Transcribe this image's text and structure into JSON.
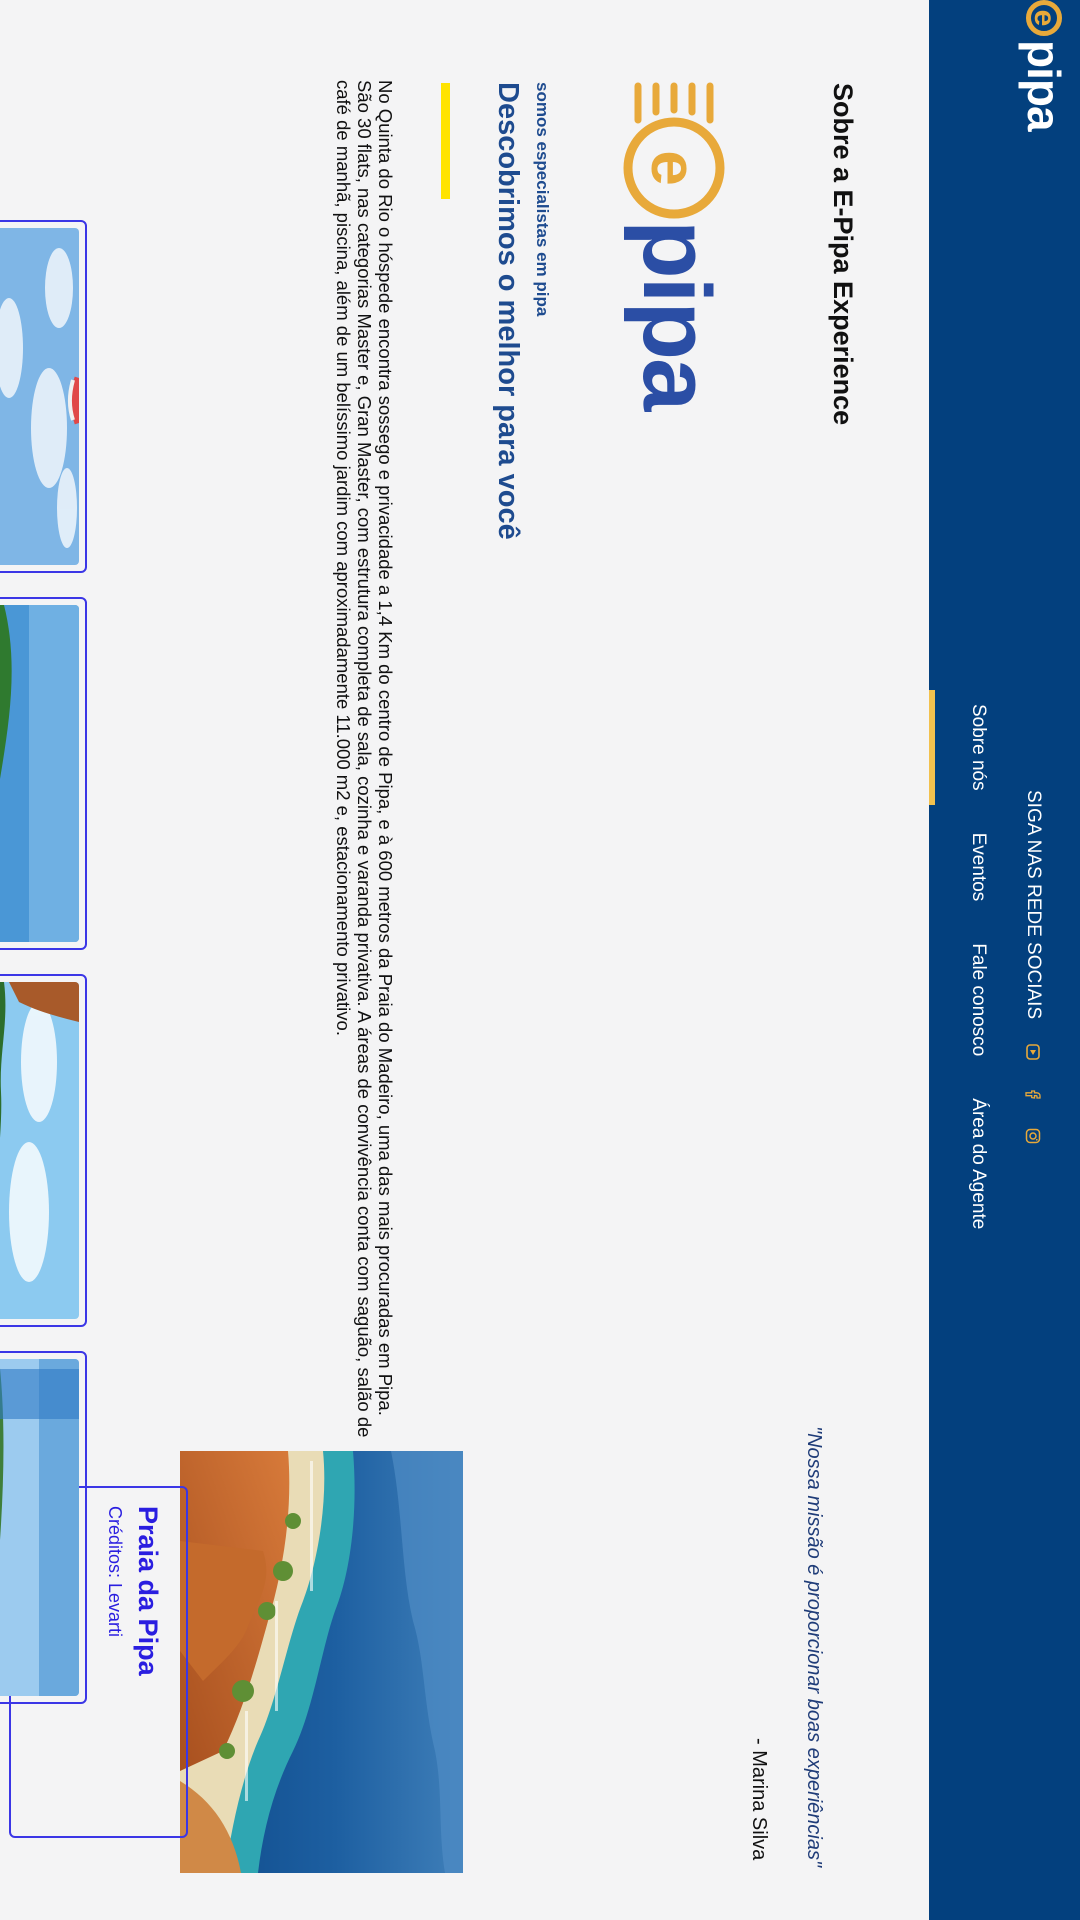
{
  "colors": {
    "header_bg": "#03407e",
    "brand_orange": "#e8a93a",
    "heading_blue": "#1e4b8f",
    "card_border": "#3b36e6",
    "accent_yellow": "#ffe300"
  },
  "header": {
    "brand": "pipa",
    "social_label": "SIGA NAS REDE SOCIAIS",
    "social_icons": [
      "youtube-icon",
      "facebook-icon",
      "instagram-icon"
    ],
    "nav": [
      {
        "label": "Sobre nós",
        "active": true
      },
      {
        "label": "Eventos",
        "active": false
      },
      {
        "label": "Fale conosco",
        "active": false
      },
      {
        "label": "Área do Agente",
        "active": false
      }
    ]
  },
  "about": {
    "title": "Sobre a E-Pipa Experience",
    "logo_word": "pipa",
    "tagline": "somos especialistas em pipa",
    "headline": "Descobrimos o melhor para você",
    "body": "No Quinta do Rio o hóspede encontra sossego e privacidade a 1,4 Km do centro de Pipa, e à 600 metros da Praia do Madeiro, uma das mais procuradas em Pipa. São 30 flats, nas categorias Master e, Gran Master, com estrutura completa de sala, cozinha e varanda privativa. A áreas de convivência conta com saguão, salão de café de manhã, piscina, além de um belíssimo jardim com aproximadamente 11.000 m2 e, estacionamento privativo.",
    "quote": "\"Nossa missão é proporcionar boas experiências\"",
    "quote_author": "- Marina Silva"
  },
  "feature": {
    "title": "Praia da Pipa",
    "credits": "Créditos: Levarti"
  },
  "gallery": [
    {
      "icon": "paraglider-photo"
    },
    {
      "icon": "coast-photo"
    },
    {
      "icon": "cliffs-photo"
    },
    {
      "icon": "beach-photo"
    }
  ]
}
